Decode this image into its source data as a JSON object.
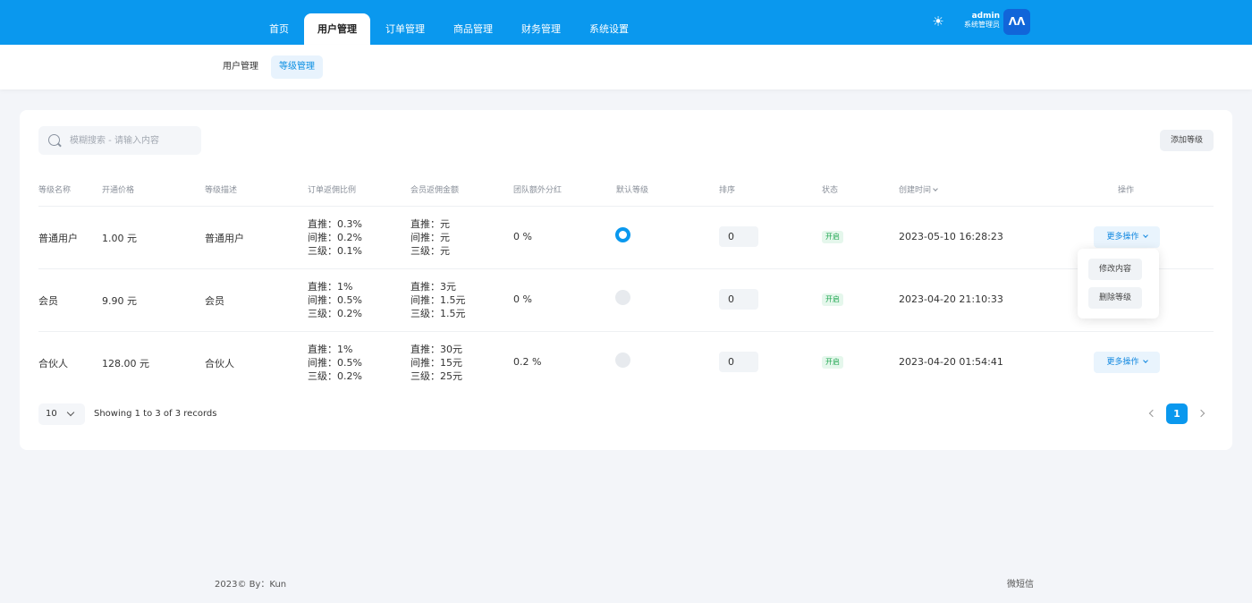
{
  "header": {
    "nav": [
      "首页",
      "用户管理",
      "订单管理",
      "商品管理",
      "财务管理",
      "系统设置"
    ],
    "active_nav": "用户管理",
    "user_name": "admin",
    "user_role": "系统管理员",
    "theme_icon": "sun-icon",
    "avatar_icon": "logo-icon",
    "accent_color": "#0a98ee"
  },
  "subnav": {
    "items": [
      "用户管理",
      "等级管理"
    ],
    "active": "等级管理"
  },
  "toolbar": {
    "search_placeholder": "模糊搜索 - 请输入内容",
    "add_label": "添加等级"
  },
  "table": {
    "columns": [
      "等级名称",
      "开通价格",
      "等级描述",
      "订单返佣比例",
      "会员返佣金额",
      "团队额外分红",
      "默认等级",
      "排序",
      "状态",
      "创建时间",
      "操作"
    ],
    "rows": [
      {
        "name": "普通用户",
        "price": "1.00 元",
        "desc": "普通用户",
        "ratio": [
          "直推：0.3%",
          "间推：0.2%",
          "三级：0.1%"
        ],
        "amount": [
          "直推：元",
          "间推：元",
          "三级：元"
        ],
        "bonus": "0 %",
        "default": true,
        "sort": "0",
        "status": "开启",
        "created": "2023-05-10 16:28:23",
        "action": "更多操作"
      },
      {
        "name": "会员",
        "price": "9.90 元",
        "desc": "会员",
        "ratio": [
          "直推：1%",
          "间推：0.5%",
          "三级：0.2%"
        ],
        "amount": [
          "直推：3元",
          "间推：1.5元",
          "三级：1.5元"
        ],
        "bonus": "0 %",
        "default": false,
        "sort": "0",
        "status": "开启",
        "created": "2023-04-20 21:10:33",
        "action": ""
      },
      {
        "name": "合伙人",
        "price": "128.00 元",
        "desc": "合伙人",
        "ratio": [
          "直推：1%",
          "间推：0.5%",
          "三级：0.2%"
        ],
        "amount": [
          "直推：30元",
          "间推：15元",
          "三级：25元"
        ],
        "bonus": "0.2 %",
        "default": false,
        "sort": "0",
        "status": "开启",
        "created": "2023-04-20 01:54:41",
        "action": "更多操作"
      }
    ]
  },
  "dropdown": {
    "edit": "修改内容",
    "delete": "删除等级"
  },
  "pagination": {
    "page_size": "10",
    "records_text": "Showing 1 to 3 of 3 records",
    "current_page": "1"
  },
  "footer": {
    "left": "2023© By：Kun",
    "right": "微短信"
  }
}
